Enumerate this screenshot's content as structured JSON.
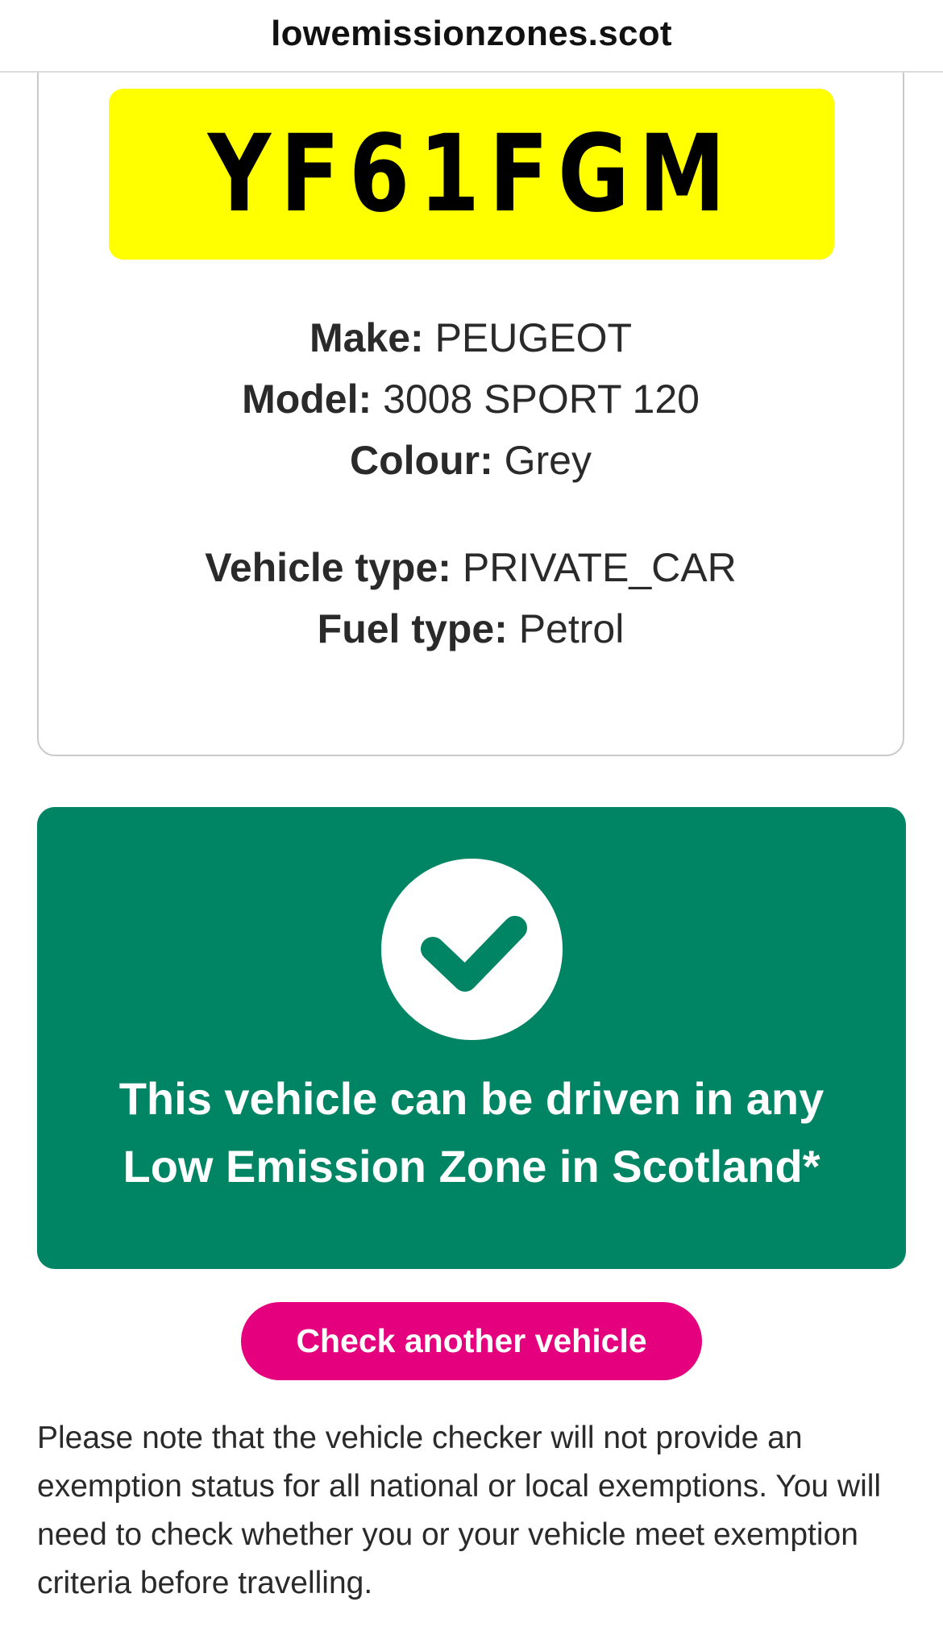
{
  "browser": {
    "url": "lowemissionzones.scot"
  },
  "vehicle": {
    "registration": "YF61FGM",
    "make_label": "Make:",
    "make": "PEUGEOT",
    "model_label": "Model:",
    "model": "3008 SPORT 120",
    "colour_label": "Colour:",
    "colour": "Grey",
    "vehicle_type_label": "Vehicle type:",
    "vehicle_type": "PRIVATE_CAR",
    "fuel_type_label": "Fuel type:",
    "fuel_type": "Petrol"
  },
  "result": {
    "icon": "check-icon",
    "line1": "This vehicle can be driven in any",
    "line2": "Low Emission Zone in Scotland*"
  },
  "actions": {
    "check_another_label": "Check another vehicle"
  },
  "note": {
    "text": "Please note that the vehicle checker will not provide an exemption status for all national or local exemptions. You will need to check whether you or your vehicle meet exemption criteria before travelling."
  },
  "colors": {
    "plate": "#ffff00",
    "success": "#008564",
    "button": "#e5007e"
  }
}
